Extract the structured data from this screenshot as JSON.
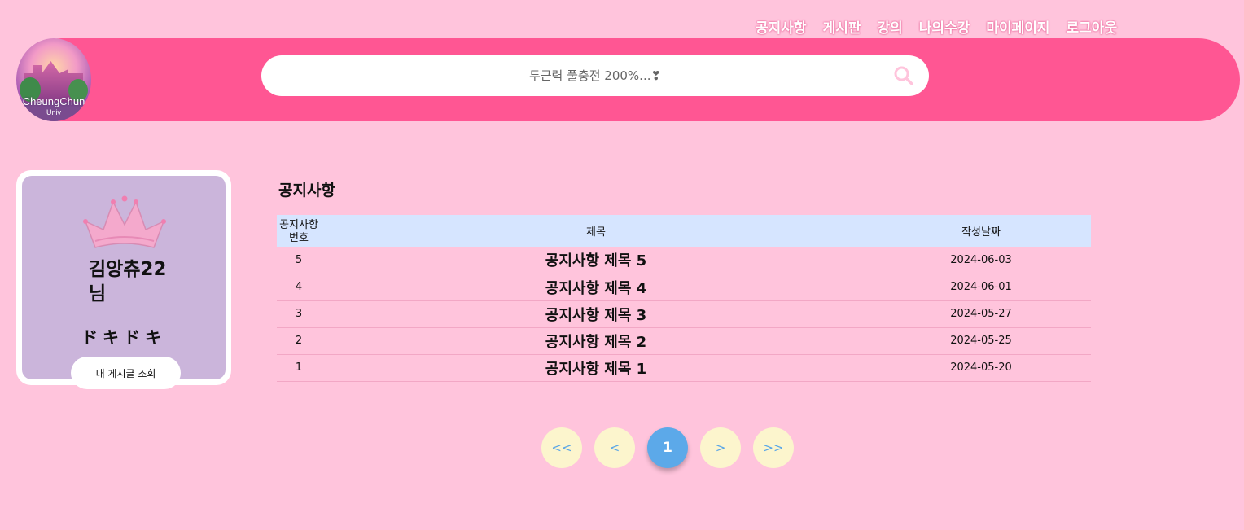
{
  "nav": {
    "items": [
      "공지사항",
      "게시판",
      "강의",
      "나의수강",
      "마이페이지",
      "로그아웃"
    ]
  },
  "logo": {
    "line1": "CheungChun",
    "line2": "Univ"
  },
  "search": {
    "placeholder": "두근력 풀충전 200%...❣"
  },
  "profile": {
    "name": "김앙츄22 님",
    "status": "ドキドキ",
    "my_posts_label": "내 게시글 조회"
  },
  "notice": {
    "title": "공지사항",
    "columns": [
      "공지사항 번호",
      "제목",
      "작성날짜"
    ],
    "rows": [
      {
        "no": "5",
        "title": "공지사항 제목 5",
        "date": "2024-06-03"
      },
      {
        "no": "4",
        "title": "공지사항 제목 4",
        "date": "2024-06-01"
      },
      {
        "no": "3",
        "title": "공지사항 제목 3",
        "date": "2024-05-27"
      },
      {
        "no": "2",
        "title": "공지사항 제목 2",
        "date": "2024-05-25"
      },
      {
        "no": "1",
        "title": "공지사항 제목 1",
        "date": "2024-05-20"
      }
    ]
  },
  "pagination": {
    "first": "<<",
    "prev": "<",
    "current": "1",
    "next": ">",
    "last": ">>"
  },
  "colors": {
    "background": "#ffc4dc",
    "header": "#ff5693",
    "profile_card": "#cbb5db",
    "table_header": "#d6e5ff",
    "pager_button": "#fcf5cd",
    "pager_active": "#5ca9e9"
  }
}
